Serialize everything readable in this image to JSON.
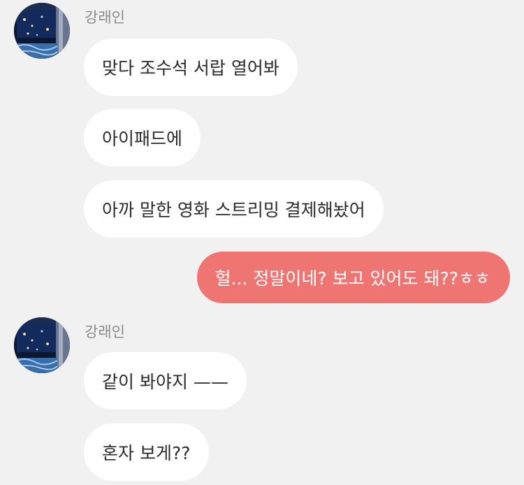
{
  "colors": {
    "background": "#f1f1f1",
    "incoming_bubble": "#ffffff",
    "outgoing_bubble": "#ef7572",
    "sender_name": "#8a8a8a"
  },
  "groups": [
    {
      "sender": "강래인",
      "avatar_icon": "night-window-photo-icon",
      "messages": [
        "맞다 조수석 서랍 열어봐",
        "아이패드에",
        "아까 말한 영화 스트리밍 결제해놨어"
      ]
    },
    {
      "outgoing": true,
      "messages": [
        "헐... 정말이네? 보고 있어도 돼??ㅎㅎ"
      ]
    },
    {
      "sender": "강래인",
      "avatar_icon": "night-window-photo-icon",
      "messages": [
        "같이 봐야지 ——",
        "혼자 보게??"
      ]
    }
  ]
}
